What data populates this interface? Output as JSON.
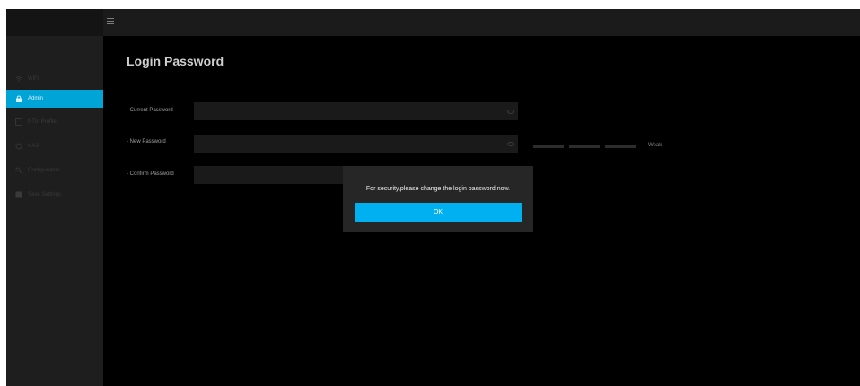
{
  "sidebar": {
    "items": [
      {
        "label": "WiFi",
        "icon": "wifi-icon",
        "active": false
      },
      {
        "label": "Admin",
        "icon": "lock-icon",
        "active": true
      },
      {
        "label": "NTM Profile",
        "icon": "profile-icon",
        "active": false
      },
      {
        "label": "NAS",
        "icon": "nas-icon",
        "active": false
      },
      {
        "label": "Configuration",
        "icon": "config-icon",
        "active": false
      },
      {
        "label": "Save Settings",
        "icon": "save-icon",
        "active": false
      }
    ]
  },
  "main": {
    "title": "Login Password",
    "fields": {
      "current_label": "- Current Password",
      "new_label": "- New Password",
      "confirm_label": "- Confirm Password",
      "current_value": "",
      "new_value": "",
      "confirm_value": ""
    },
    "strength": {
      "label": "Weak"
    }
  },
  "dialog": {
    "message": "For security,please change the login password now.",
    "ok_label": "OK"
  },
  "colors": {
    "accent": "#00a4d6",
    "ok_button": "#00b0f0",
    "background": "#000000",
    "sidebar": "#1e1e1e"
  }
}
